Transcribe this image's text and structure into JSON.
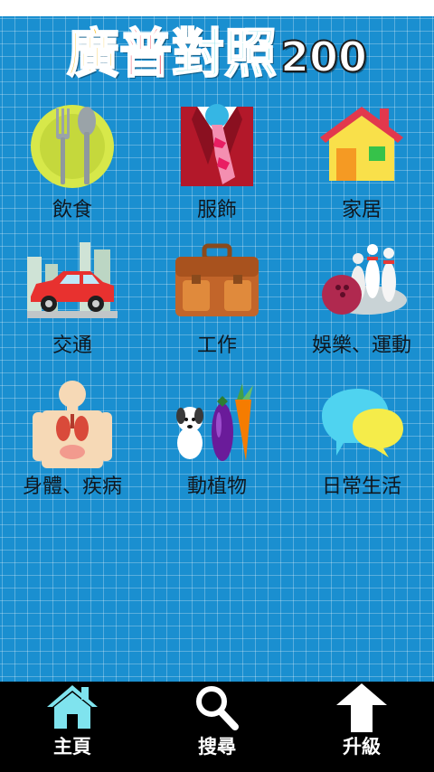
{
  "app": {
    "title_chars": [
      "廣",
      "普",
      "對",
      "照",
      "200"
    ]
  },
  "categories": [
    {
      "label": "飲食",
      "icon": "dining-icon"
    },
    {
      "label": "服飾",
      "icon": "clothing-icon"
    },
    {
      "label": "家居",
      "icon": "house-icon"
    },
    {
      "label": "交通",
      "icon": "car-icon"
    },
    {
      "label": "工作",
      "icon": "briefcase-icon"
    },
    {
      "label": "娛樂、運動",
      "icon": "bowling-icon"
    },
    {
      "label": "身體、疾病",
      "icon": "body-organs-icon"
    },
    {
      "label": "動植物",
      "icon": "animals-plants-icon"
    },
    {
      "label": "日常生活",
      "icon": "speech-bubbles-icon"
    }
  ],
  "bottom_nav": [
    {
      "label": "主頁",
      "icon": "home-icon"
    },
    {
      "label": "搜尋",
      "icon": "search-icon"
    },
    {
      "label": "升級",
      "icon": "upgrade-arrow-icon"
    }
  ],
  "colors": {
    "background": "#1a8fd0",
    "bottom_bar": "#000000",
    "title_yellow": "#f7b500",
    "title_red": "#e8162d",
    "title_cyan": "#57d6e0"
  }
}
